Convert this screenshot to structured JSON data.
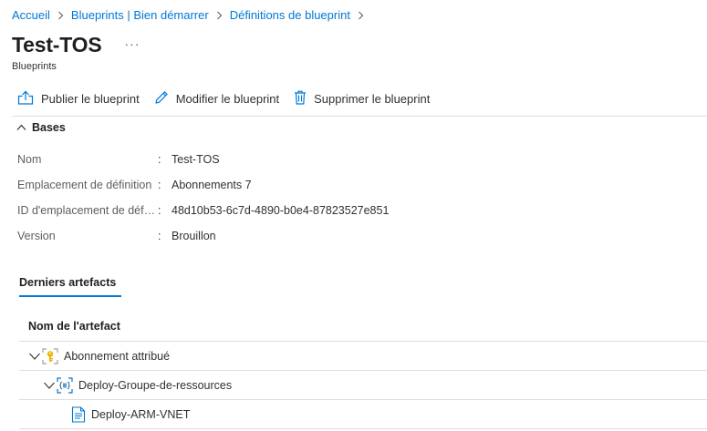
{
  "breadcrumb": [
    "Accueil",
    "Blueprints | Bien démarrer",
    "Définitions de blueprint"
  ],
  "header": {
    "title": "Test-TOS",
    "more": "···",
    "subtitle": "Blueprints"
  },
  "toolbar": {
    "publish": "Publier le blueprint",
    "edit": "Modifier le blueprint",
    "delete": "Supprimer le blueprint"
  },
  "essentials": {
    "title": "Bases",
    "rows": [
      {
        "label": "Nom",
        "value": "Test-TOS"
      },
      {
        "label": "Emplacement de définition",
        "value": "Abonnements 7"
      },
      {
        "label": "ID d'emplacement de déf…",
        "value": "48d10b53-6c7d-4890-b0e4-87823527e851"
      },
      {
        "label": "Version",
        "value": "Brouillon"
      }
    ]
  },
  "artifacts": {
    "tab": "Derniers artefacts",
    "column": "Nom de l'artefact",
    "items": [
      {
        "name": "Abonnement attribué",
        "icon": "subscription-key-icon"
      },
      {
        "name": "Deploy-Groupe-de-ressources",
        "icon": "resource-group-icon"
      },
      {
        "name": "Deploy-ARM-VNET",
        "icon": "arm-template-icon"
      }
    ]
  },
  "colors": {
    "accent": "#0078d4",
    "text": "#323130",
    "muted": "#605e5c",
    "divider": "#e1dfdd",
    "key": "#f0b400"
  }
}
